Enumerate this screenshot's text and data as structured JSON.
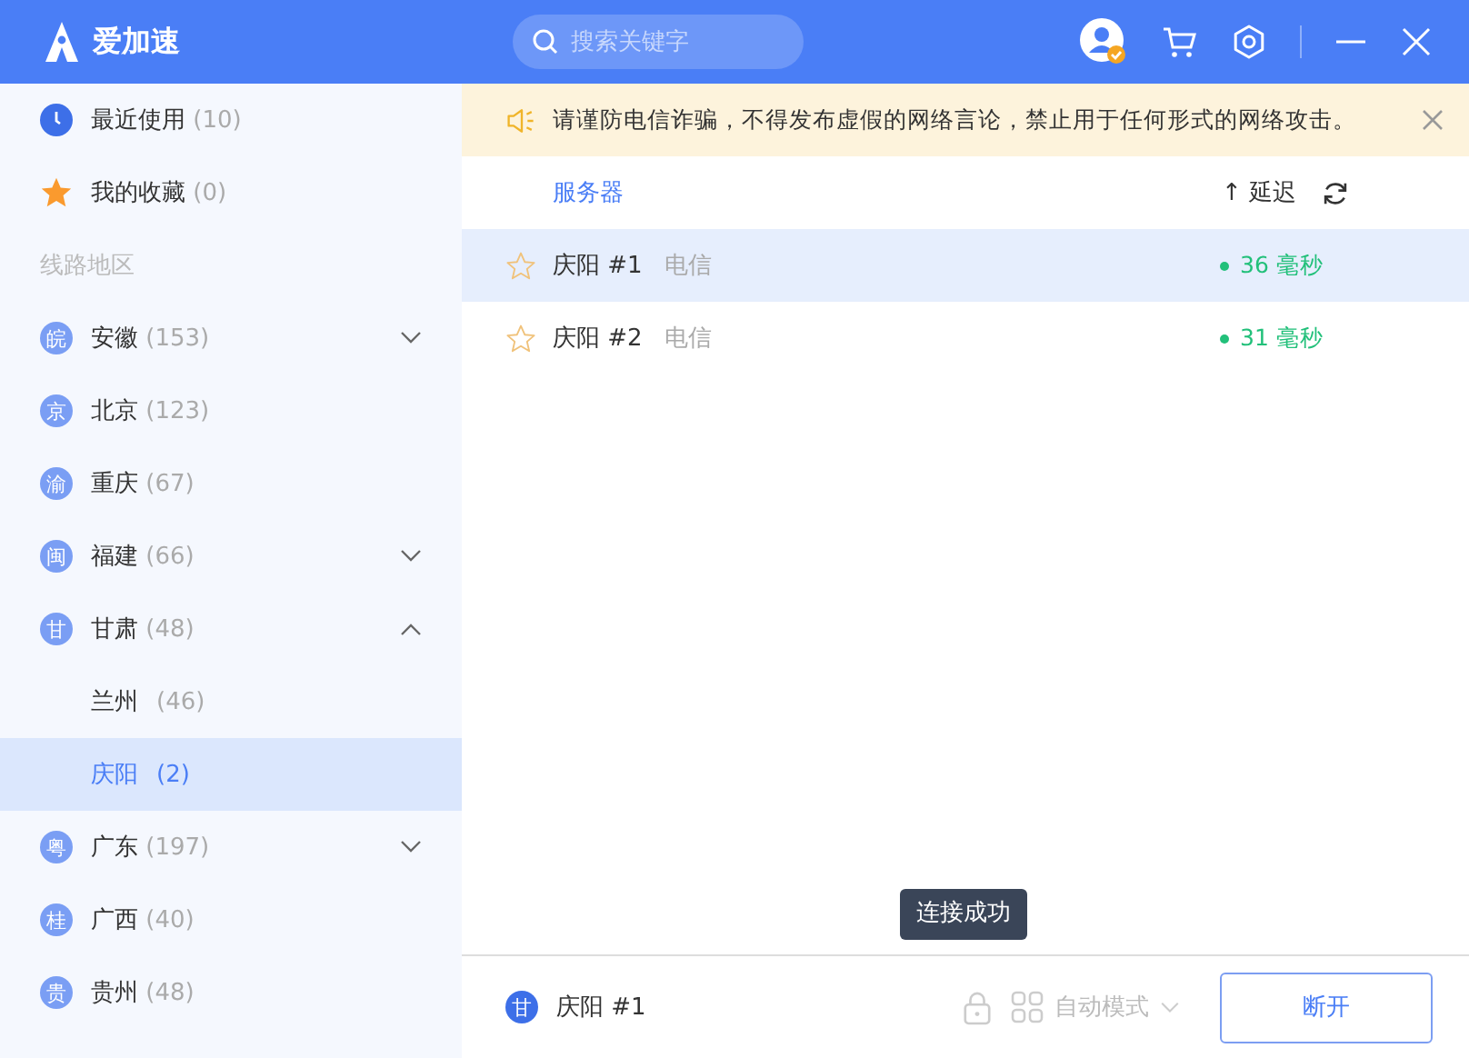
{
  "app": {
    "title": "爱加速"
  },
  "search": {
    "placeholder": "搜索关键字"
  },
  "sidebar": {
    "items": [
      {
        "kind": "recent",
        "label": "最近使用",
        "count": "(10)"
      },
      {
        "kind": "favorite",
        "label": "我的收藏",
        "count": "(0)"
      },
      {
        "kind": "section",
        "label": "线路地区"
      },
      {
        "kind": "region",
        "badge": "皖",
        "label": "安徽",
        "count": "(153)",
        "expanded": false
      },
      {
        "kind": "region",
        "badge": "京",
        "label": "北京",
        "count": "(123)"
      },
      {
        "kind": "region",
        "badge": "渝",
        "label": "重庆",
        "count": "(67)"
      },
      {
        "kind": "region",
        "badge": "闽",
        "label": "福建",
        "count": "(66)",
        "expanded": false
      },
      {
        "kind": "region",
        "badge": "甘",
        "label": "甘肃",
        "count": "(48)",
        "expanded": true,
        "children": [
          {
            "label": "兰州",
            "count": "(46)",
            "selected": false
          },
          {
            "label": "庆阳",
            "count": "(2)",
            "selected": true
          }
        ]
      },
      {
        "kind": "region",
        "badge": "粤",
        "label": "广东",
        "count": "(197)",
        "expanded": false
      },
      {
        "kind": "region",
        "badge": "桂",
        "label": "广西",
        "count": "(40)"
      },
      {
        "kind": "region",
        "badge": "贵",
        "label": "贵州",
        "count": "(48)"
      }
    ]
  },
  "notice": {
    "text": "请谨防电信诈骗，不得发布虚假的网络言论，禁止用于任何形式的网络攻击。"
  },
  "table": {
    "columns": [
      {
        "label": "服务器"
      },
      {
        "label": "延迟",
        "sort_arrow": "↑"
      }
    ],
    "rows": [
      {
        "name": "庆阳 #1",
        "isp": "电信",
        "latency": "36 毫秒",
        "favorite": false,
        "selected": true
      },
      {
        "name": "庆阳 #2",
        "isp": "电信",
        "latency": "31 毫秒",
        "favorite": false,
        "selected": false
      }
    ]
  },
  "toast": {
    "text": "连接成功"
  },
  "footer": {
    "badge": "甘",
    "server": "庆阳 #1",
    "mode": "自动模式",
    "button": "断开"
  }
}
